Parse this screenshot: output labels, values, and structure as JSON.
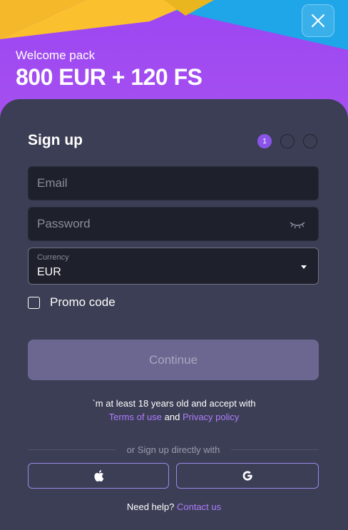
{
  "banner": {
    "subtitle": "Welcome pack",
    "offer": "800 EUR + 120 FS"
  },
  "icons": {
    "close": "close-icon",
    "eye": "eye-closed-icon",
    "apple": "apple-icon",
    "google": "google-icon"
  },
  "form": {
    "title": "Sign up",
    "steps": [
      "1",
      "",
      ""
    ],
    "email_placeholder": "Email",
    "password_placeholder": "Password",
    "currency_label": "Currency",
    "currency_value": "EUR",
    "promo_label": "Promo code",
    "continue_label": "Continue",
    "terms_line1": "`m at least 18 years old and accept with",
    "terms_link1": "Terms of use",
    "terms_and": " and ",
    "terms_link2": "Privacy policy",
    "divider_text": "or Sign up directly with",
    "help_text": "Need help? ",
    "help_link": "Contact us"
  },
  "colors": {
    "accent": "#8a54ea",
    "banner": "#9b46f2",
    "panel": "#3b3e54",
    "link": "#b07cff",
    "continue_disabled": "#6b6790"
  }
}
